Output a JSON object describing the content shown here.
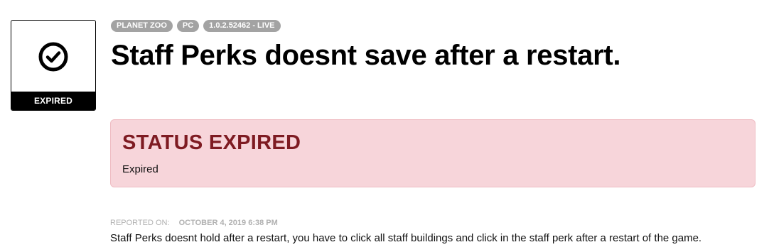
{
  "status_card": {
    "icon": "check-circle-icon",
    "label": "EXPIRED"
  },
  "tags": [
    {
      "label": "PLANET ZOO"
    },
    {
      "label": "PC"
    },
    {
      "label": "1.0.2.52462 - LIVE"
    }
  ],
  "title": "Staff Perks doesnt save after a restart.",
  "status_box": {
    "heading": "STATUS EXPIRED",
    "detail": "Expired",
    "background_color": "#f7d5da",
    "heading_color": "#7e1b22"
  },
  "reported": {
    "label": "REPORTED ON:",
    "date": "OCTOBER 4, 2019 6:38 PM"
  },
  "description": "Staff Perks doesnt hold after a restart, you have to click all staff buildings and click in the staff perk after a restart of the game."
}
